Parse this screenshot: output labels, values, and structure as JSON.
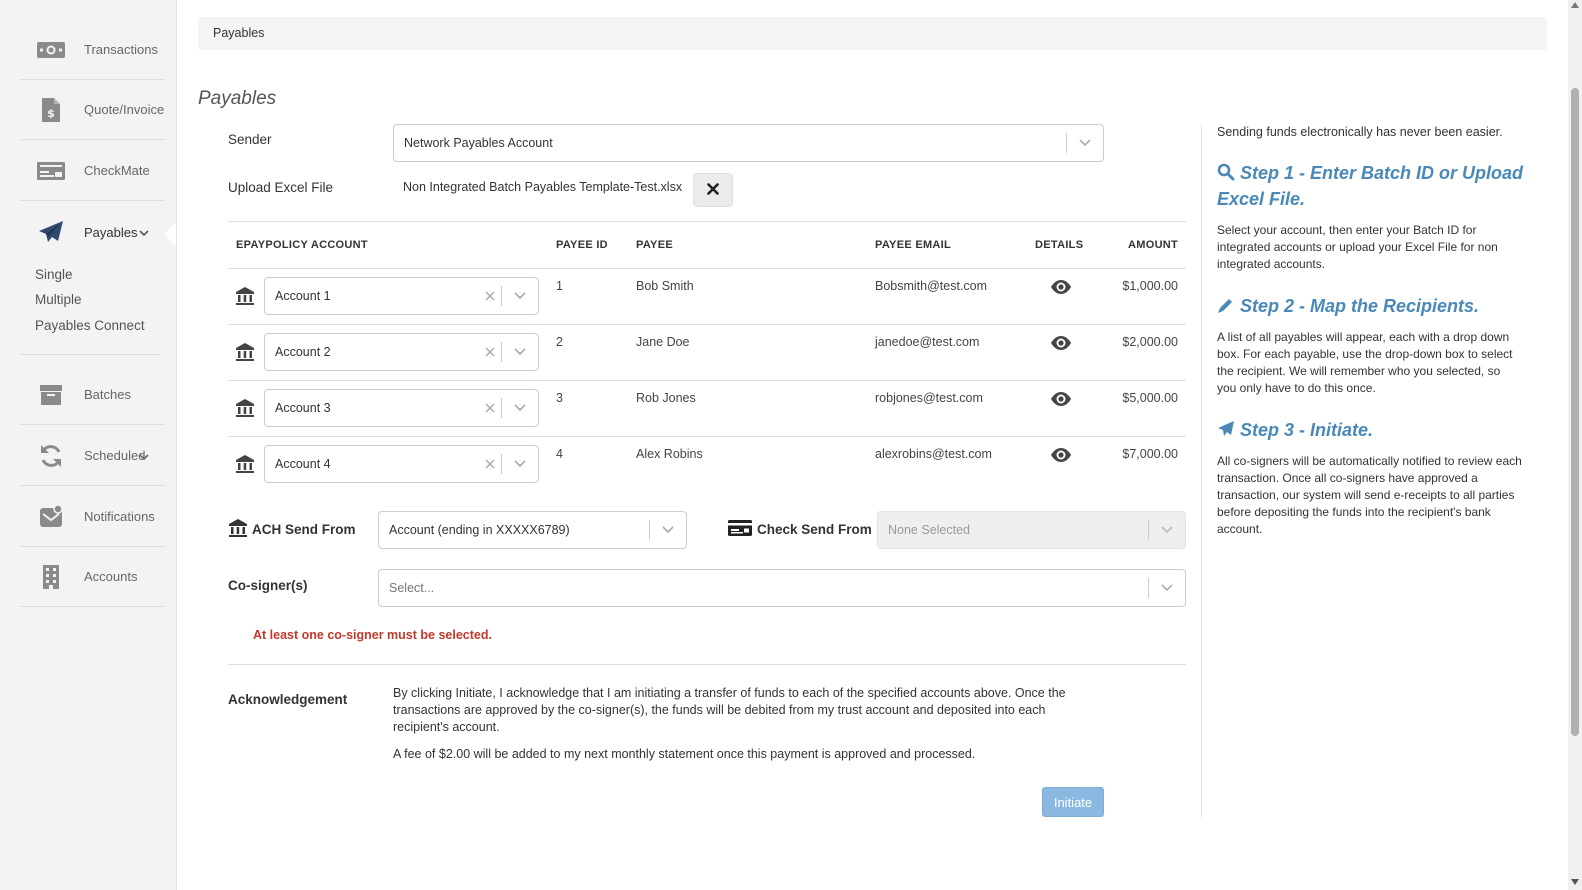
{
  "sidebar": {
    "items": [
      {
        "label": "Transactions",
        "icon": "cash-icon"
      },
      {
        "label": "Quote/Invoice",
        "icon": "invoice-icon"
      },
      {
        "label": "CheckMate",
        "icon": "check-icon"
      },
      {
        "label": "Payables",
        "icon": "paper-plane-icon",
        "active": true,
        "expanded": true
      },
      {
        "label": "Batches",
        "icon": "archive-box-icon"
      },
      {
        "label": "Scheduled",
        "icon": "refresh-icon",
        "expandable": true
      },
      {
        "label": "Notifications",
        "icon": "notifications-icon"
      },
      {
        "label": "Accounts",
        "icon": "building-icon"
      }
    ],
    "payables_sub": [
      "Single",
      "Multiple",
      "Payables Connect"
    ]
  },
  "breadcrumb": "Payables",
  "page_title": "Payables",
  "form": {
    "sender_label": "Sender",
    "sender_value": "Network Payables Account",
    "upload_label": "Upload Excel File",
    "upload_filename": "Non Integrated Batch Payables Template-Test.xlsx"
  },
  "table": {
    "headers": {
      "account": "EPAYPOLICY ACCOUNT",
      "payee_id": "PAYEE ID",
      "payee": "PAYEE",
      "payee_email": "PAYEE EMAIL",
      "details": "DETAILS",
      "amount": "AMOUNT"
    },
    "rows": [
      {
        "account": "Account 1",
        "payee_id": "1",
        "payee": "Bob Smith",
        "email": "Bobsmith@test.com",
        "amount": "$1,000.00"
      },
      {
        "account": "Account 2",
        "payee_id": "2",
        "payee": "Jane Doe",
        "email": "janedoe@test.com",
        "amount": "$2,000.00"
      },
      {
        "account": "Account 3",
        "payee_id": "3",
        "payee": "Rob Jones",
        "email": "robjones@test.com",
        "amount": "$5,000.00"
      },
      {
        "account": "Account 4",
        "payee_id": "4",
        "payee": "Alex Robins",
        "email": "alexrobins@test.com",
        "amount": "$7,000.00"
      }
    ]
  },
  "send_from": {
    "ach_label": "ACH Send From",
    "ach_value": "Account (ending in XXXXX6789)",
    "check_label": "Check Send From",
    "check_value": "None Selected"
  },
  "cosigners": {
    "label": "Co-signer(s)",
    "placeholder": "Select...",
    "error": "At least one co-signer must be selected."
  },
  "acknowledgement": {
    "label": "Acknowledgement",
    "text1": "By clicking Initiate, I acknowledge that I am initiating a transfer of funds to each of the specified accounts above. Once the transactions are approved by the co-signer(s), the funds will be debited from my trust account and deposited into each recipient's account.",
    "text2": "A fee of $2.00 will be added to my next monthly statement once this payment is approved and processed."
  },
  "initiate_label": "Initiate",
  "help": {
    "intro": "Sending funds electronically has never been easier.",
    "step1_title": "Step 1 - Enter Batch ID or Upload Excel File.",
    "step1_body": "Select your account, then enter your Batch ID for integrated accounts or upload your Excel File for non integrated accounts.",
    "step2_title": "Step 2 - Map the Recipients.",
    "step2_body": "A list of all payables will appear, each with a drop down box. For each payable, use the drop-down box to select the recipient. We will remember who you selected, so you only have to do this once.",
    "step3_title": "Step 3 - Initiate.",
    "step3_body": "All co-signers will be automatically notified to review each transaction. Once all co-signers have approved a transaction, our system will send e-receipts to all parties before depositing the funds into the recipient's bank account."
  },
  "colors": {
    "accent": "#4a88b8",
    "error": "#c0392b",
    "button": "#8ab8e0"
  }
}
